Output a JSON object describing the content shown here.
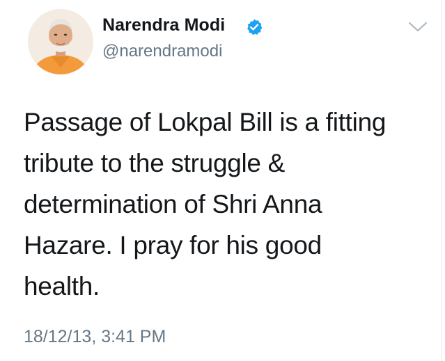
{
  "author": {
    "display_name": "Narendra Modi",
    "handle": "@narendramodi",
    "verified": true,
    "verified_icon": "verified-badge-icon",
    "avatar_icon": "profile-photo"
  },
  "tweet": {
    "lines": [
      "Passage of Lokpal Bill is a fitting",
      "tribute to the struggle &",
      "determination of Shri Anna",
      "Hazare. I pray for his good",
      "health."
    ],
    "timestamp": "18/12/13, 3:41 PM"
  },
  "menu": {
    "icon": "chevron-down-icon"
  },
  "colors": {
    "primary_text": "#14171a",
    "secondary_text": "#657786",
    "verified_blue": "#1da1f2",
    "chevron": "#aab8c2"
  }
}
